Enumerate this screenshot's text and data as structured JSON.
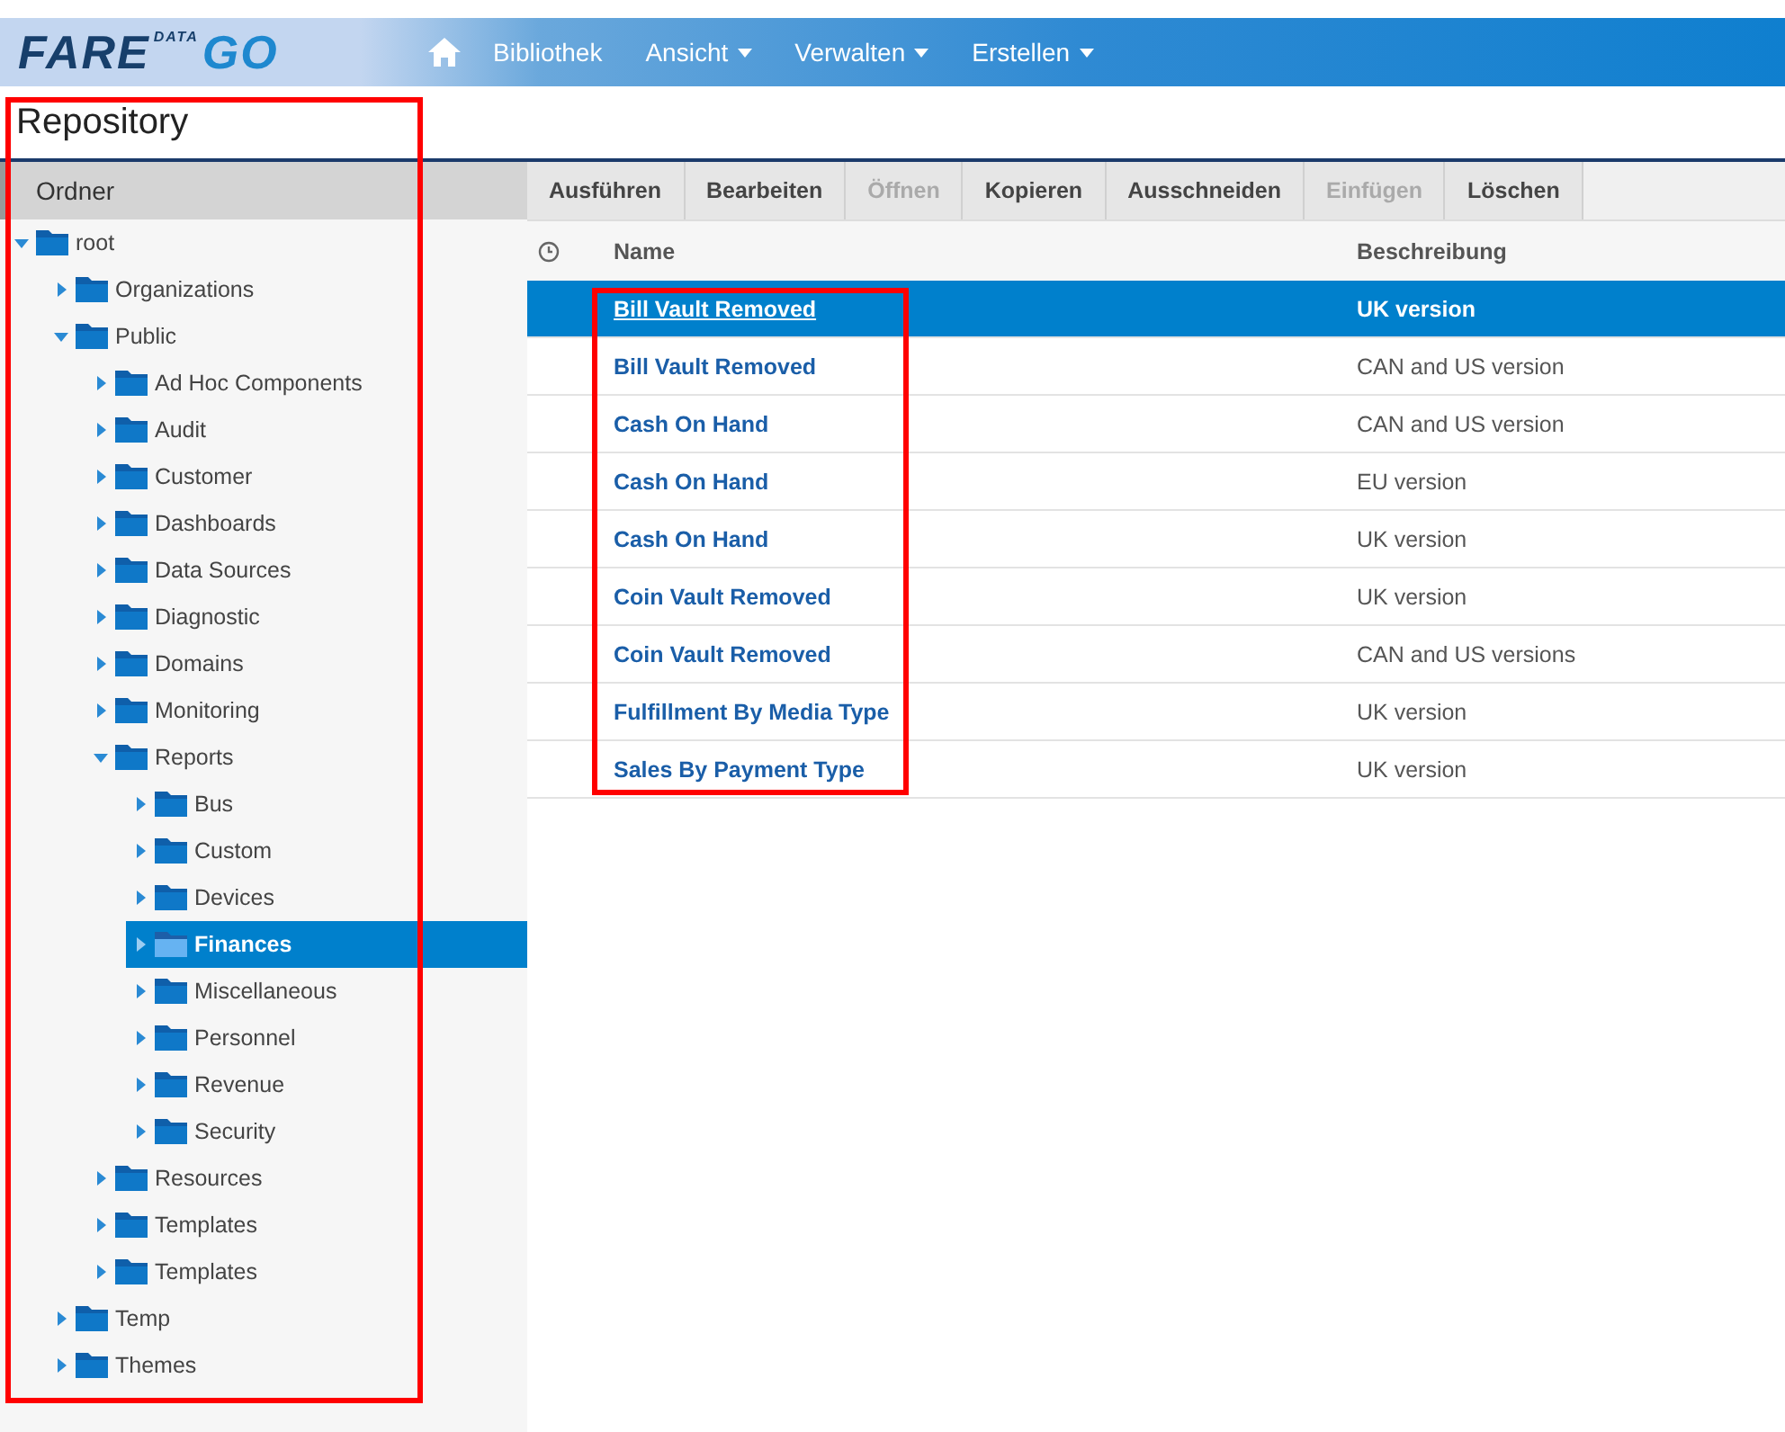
{
  "navbar": {
    "logo": {
      "main": "FARE",
      "sup": "DATA",
      "end": "GO"
    },
    "items": [
      {
        "label": "Bibliothek",
        "dropdown": false
      },
      {
        "label": "Ansicht",
        "dropdown": true
      },
      {
        "label": "Verwalten",
        "dropdown": true
      },
      {
        "label": "Erstellen",
        "dropdown": true
      }
    ]
  },
  "page_title": "Repository",
  "sidebar": {
    "header": "Ordner",
    "framed": true,
    "tree": [
      {
        "label": "root",
        "expanded": true,
        "selected": false,
        "children": [
          {
            "label": "Organizations",
            "expanded": false,
            "selected": false
          },
          {
            "label": "Public",
            "expanded": true,
            "selected": false,
            "children": [
              {
                "label": "Ad Hoc Components",
                "expanded": false,
                "selected": false
              },
              {
                "label": "Audit",
                "expanded": false,
                "selected": false
              },
              {
                "label": "Customer",
                "expanded": false,
                "selected": false
              },
              {
                "label": "Dashboards",
                "expanded": false,
                "selected": false
              },
              {
                "label": "Data Sources",
                "expanded": false,
                "selected": false
              },
              {
                "label": "Diagnostic",
                "expanded": false,
                "selected": false
              },
              {
                "label": "Domains",
                "expanded": false,
                "selected": false
              },
              {
                "label": "Monitoring",
                "expanded": false,
                "selected": false
              },
              {
                "label": "Reports",
                "expanded": true,
                "selected": false,
                "children": [
                  {
                    "label": "Bus",
                    "expanded": false,
                    "selected": false
                  },
                  {
                    "label": "Custom",
                    "expanded": false,
                    "selected": false
                  },
                  {
                    "label": "Devices",
                    "expanded": false,
                    "selected": false
                  },
                  {
                    "label": "Finances",
                    "expanded": false,
                    "selected": true
                  },
                  {
                    "label": "Miscellaneous",
                    "expanded": false,
                    "selected": false
                  },
                  {
                    "label": "Personnel",
                    "expanded": false,
                    "selected": false
                  },
                  {
                    "label": "Revenue",
                    "expanded": false,
                    "selected": false
                  },
                  {
                    "label": "Security",
                    "expanded": false,
                    "selected": false
                  }
                ]
              },
              {
                "label": "Resources",
                "expanded": false,
                "selected": false
              },
              {
                "label": "Templates",
                "expanded": false,
                "selected": false
              },
              {
                "label": "Templates",
                "expanded": false,
                "selected": false
              }
            ]
          },
          {
            "label": "Temp",
            "expanded": false,
            "selected": false
          },
          {
            "label": "Themes",
            "expanded": false,
            "selected": false
          }
        ]
      }
    ]
  },
  "toolbar": [
    {
      "label": "Ausführen",
      "disabled": false
    },
    {
      "label": "Bearbeiten",
      "disabled": false
    },
    {
      "label": "Öffnen",
      "disabled": true
    },
    {
      "label": "Kopieren",
      "disabled": false
    },
    {
      "label": "Ausschneiden",
      "disabled": false
    },
    {
      "label": "Einfügen",
      "disabled": true
    },
    {
      "label": "Löschen",
      "disabled": false
    }
  ],
  "table": {
    "columns": [
      "Name",
      "Beschreibung"
    ],
    "name_column_framed": true,
    "rows": [
      {
        "name": "Bill Vault Removed",
        "description": "UK version",
        "selected": true
      },
      {
        "name": "Bill Vault Removed",
        "description": "CAN and US version",
        "selected": false
      },
      {
        "name": "Cash On Hand",
        "description": "CAN and US version",
        "selected": false
      },
      {
        "name": "Cash On Hand",
        "description": "EU version",
        "selected": false
      },
      {
        "name": "Cash On Hand",
        "description": "UK version",
        "selected": false
      },
      {
        "name": "Coin Vault Removed",
        "description": "UK version",
        "selected": false
      },
      {
        "name": "Coin Vault Removed",
        "description": "CAN and US versions",
        "selected": false
      },
      {
        "name": "Fulfillment By Media Type",
        "description": "UK version",
        "selected": false
      },
      {
        "name": "Sales By Payment Type",
        "description": "UK version",
        "selected": false
      }
    ]
  }
}
